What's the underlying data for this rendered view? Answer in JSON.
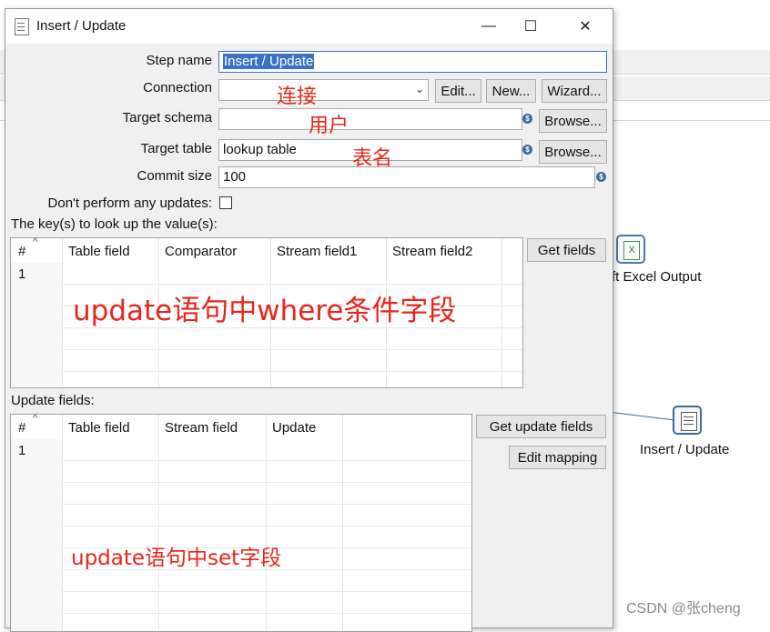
{
  "dialog": {
    "title": "Insert / Update",
    "window_buttons": {
      "minimize": "—",
      "maximize": "☐",
      "close": "✕"
    }
  },
  "form": {
    "step_name_label": "Step name",
    "step_name_value": "Insert / Update",
    "connection_label": "Connection",
    "connection_value": "",
    "edit_button": "Edit...",
    "new_button": "New...",
    "wizard_button": "Wizard...",
    "target_schema_label": "Target schema",
    "target_schema_value": "",
    "browse_button": "Browse...",
    "target_table_label": "Target table",
    "target_table_value": "lookup table",
    "commit_size_label": "Commit size",
    "commit_size_value": "100",
    "dont_update_label": "Don't perform any updates:",
    "dont_update_checked": false
  },
  "keys": {
    "section_label": "The key(s) to look up the value(s):",
    "get_fields_button": "Get fields",
    "columns": [
      "#",
      "Table field",
      "Comparator",
      "Stream field1",
      "Stream field2"
    ],
    "rows": [
      [
        "1",
        "",
        "",
        "",
        ""
      ]
    ]
  },
  "update_fields": {
    "section_label": "Update fields:",
    "get_update_fields_button": "Get update fields",
    "edit_mapping_button": "Edit mapping",
    "columns": [
      "#",
      "Table field",
      "Stream field",
      "Update"
    ],
    "rows": [
      [
        "1",
        "",
        "",
        ""
      ]
    ]
  },
  "annotations": {
    "connection": "连接",
    "schema": "用户",
    "table": "表名",
    "where_fields": "update语句中where条件字段",
    "set_fields": "update语句中set字段"
  },
  "canvas": {
    "excel_output_label": "ft Excel Output",
    "insert_update_label": "Insert / Update",
    "watermark": "CSDN @张cheng"
  },
  "colors": {
    "annotation": "#e8261c",
    "selection": "#3a72c4",
    "dialog_bg": "#f0f0f0"
  }
}
